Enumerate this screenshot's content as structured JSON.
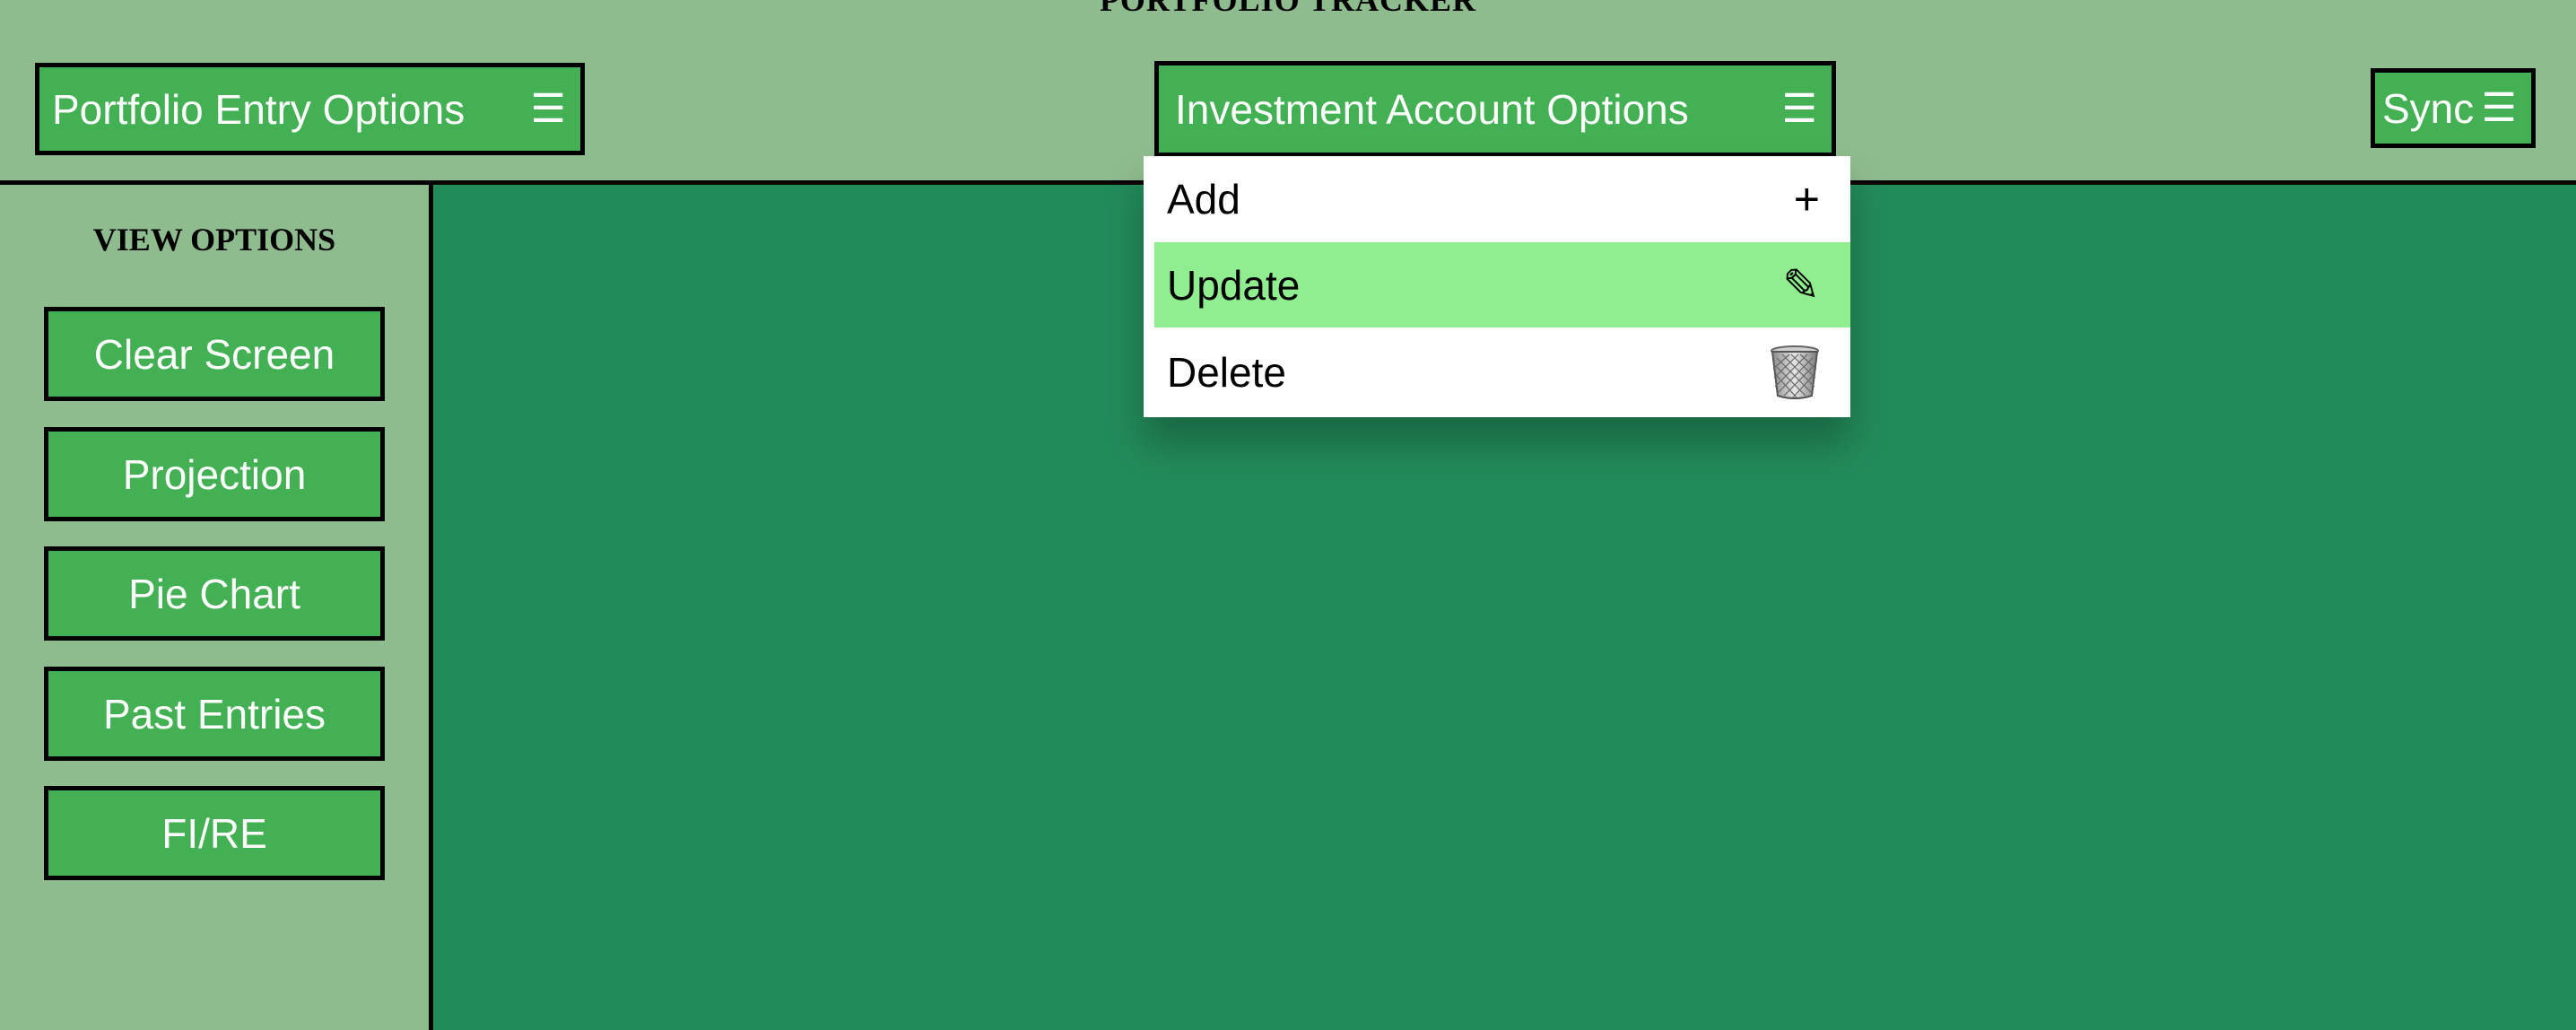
{
  "app": {
    "title": "PORTFOLIO TRACKER"
  },
  "header": {
    "entry_menu": {
      "label": "Portfolio Entry Options",
      "icon": "hamburger-icon"
    },
    "account_menu": {
      "label": "Investment Account Options",
      "icon": "hamburger-icon"
    },
    "sync_menu": {
      "label": "Sync",
      "icon": "hamburger-icon"
    }
  },
  "sidebar": {
    "title": "VIEW OPTIONS",
    "buttons": [
      "Clear Screen",
      "Projection",
      "Pie Chart",
      "Past Entries",
      "FI/RE"
    ]
  },
  "dropdown": {
    "items": [
      {
        "label": "Add",
        "icon": "plus-icon",
        "glyph": "+"
      },
      {
        "label": "Update",
        "icon": "pencil-icon",
        "glyph": "✎",
        "highlighted": true
      },
      {
        "label": "Delete",
        "icon": "trash-icon"
      }
    ]
  },
  "colors": {
    "header_bg": "#8fbc8f",
    "main_bg": "#228b5a",
    "button_bg": "#43b053",
    "highlight": "#90ee90"
  }
}
